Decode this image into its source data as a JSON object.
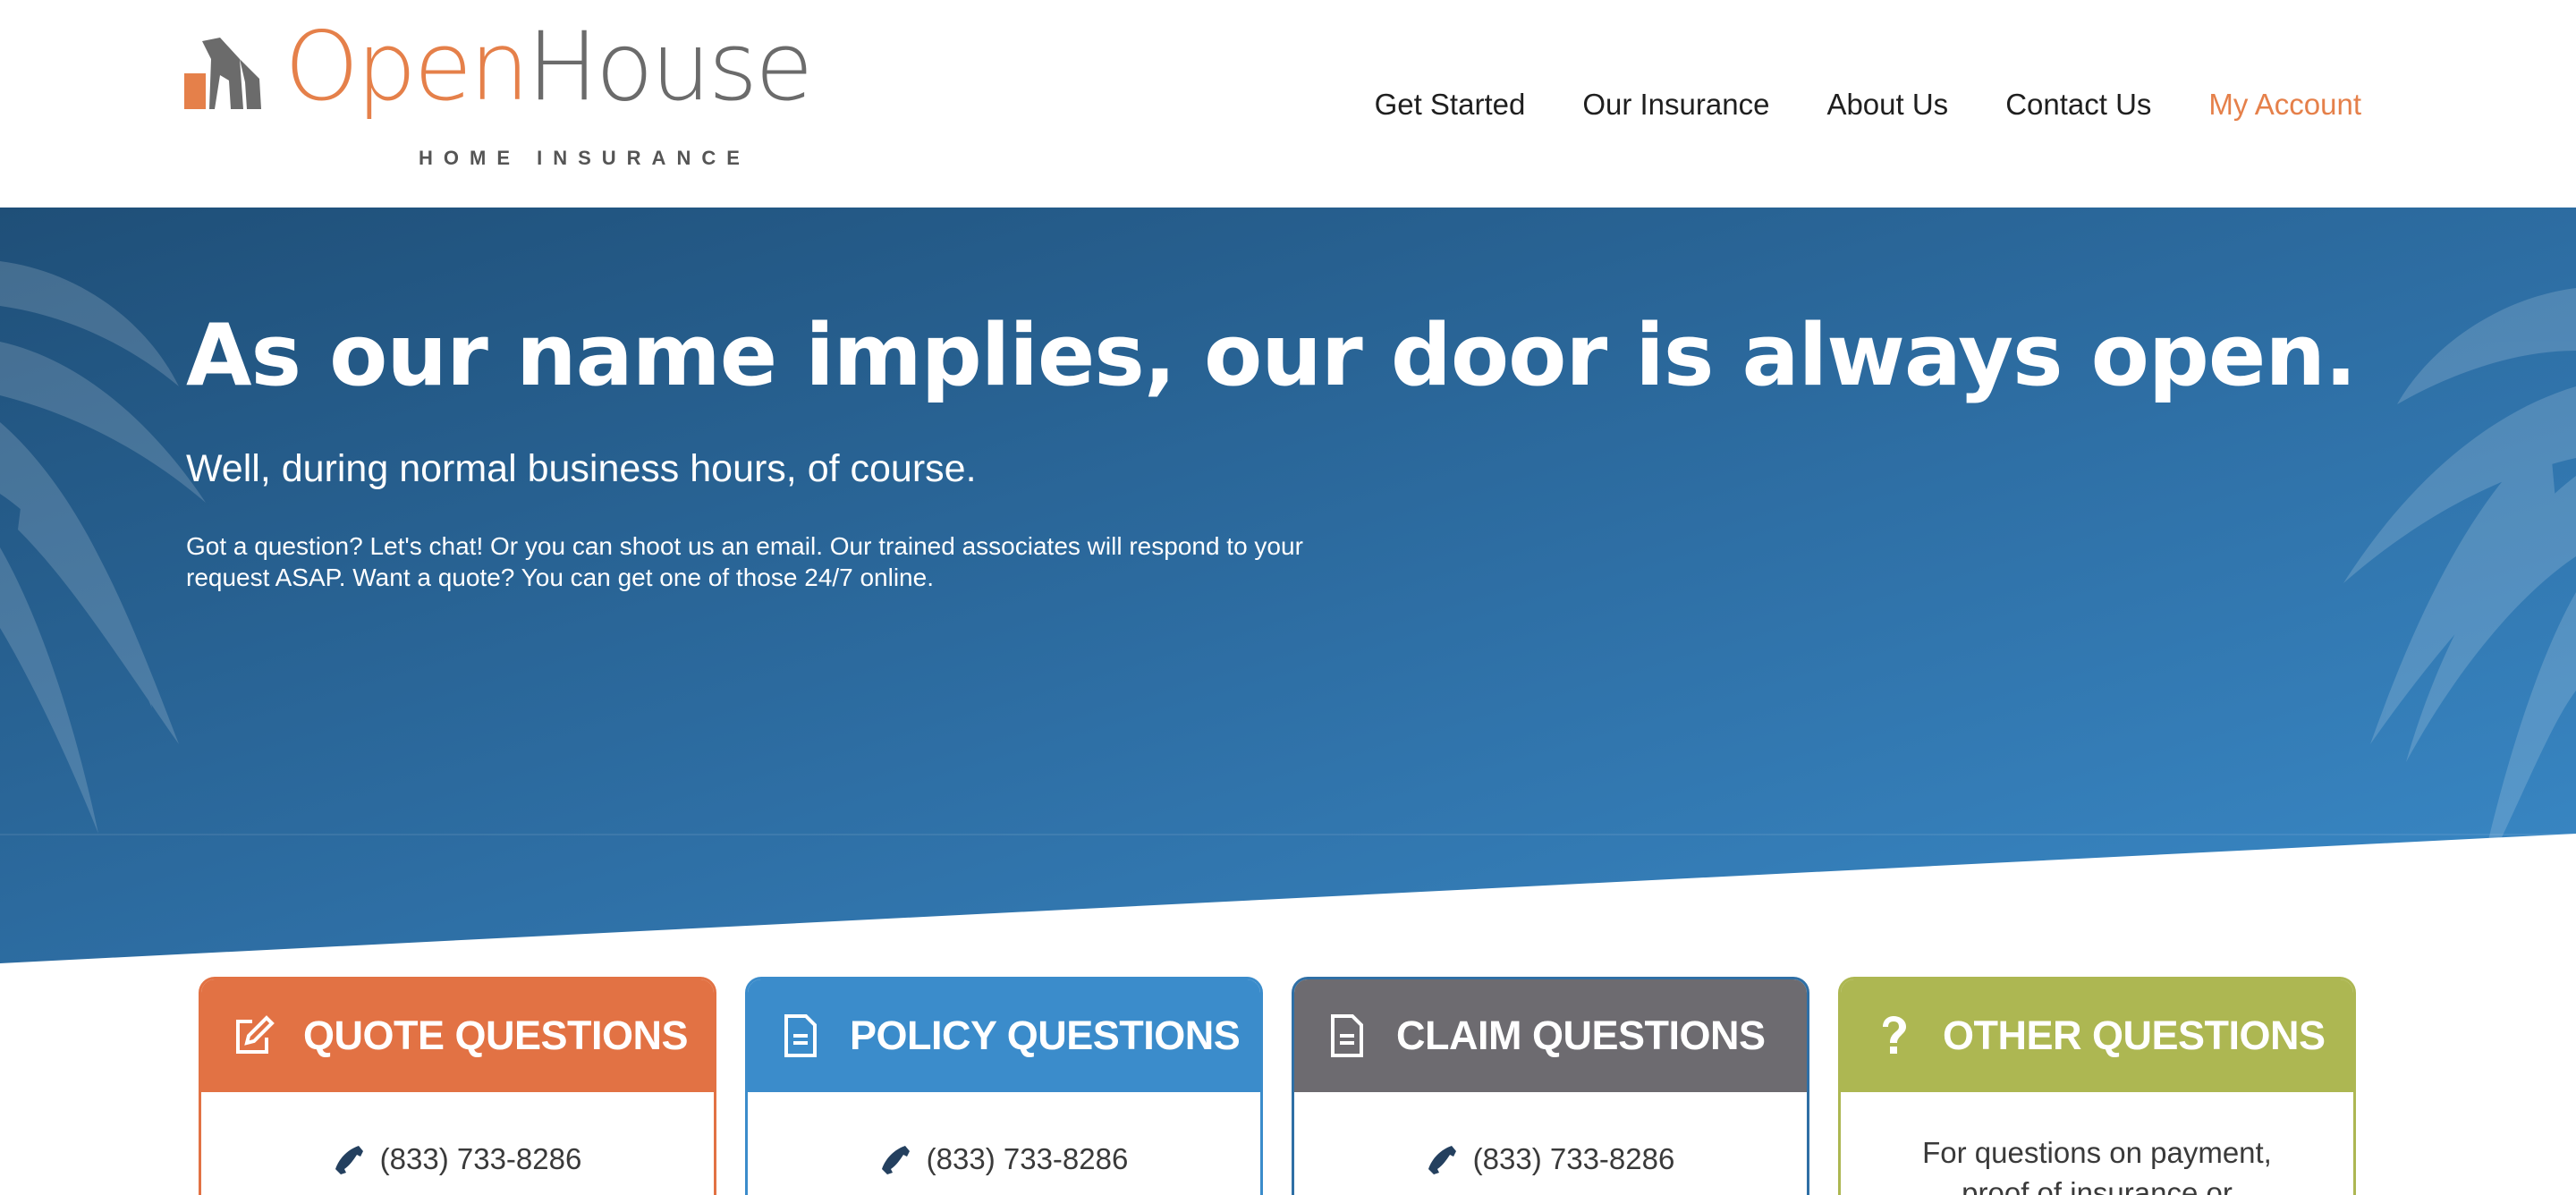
{
  "brand": {
    "name_part1": "Open",
    "name_part2": "House",
    "tagline": "HOME INSURANCE",
    "color_orange": "#e5804a",
    "color_gray": "#6b6b6b"
  },
  "nav": {
    "items": [
      {
        "label": "Get Started"
      },
      {
        "label": "Our Insurance"
      },
      {
        "label": "About Us"
      },
      {
        "label": "Contact Us"
      },
      {
        "label": "My Account"
      }
    ]
  },
  "hero": {
    "title": "As our name implies, our door is always open.",
    "subtitle": "Well, during normal business hours, of course.",
    "body": "Got a question? Let's chat! Or you can shoot us an email. Our trained associates will respond to your request ASAP. Want a quote? You can get one of those 24/7 online."
  },
  "cards": [
    {
      "title": "QUOTE QUESTIONS",
      "icon": "edit-icon",
      "color": "#e27244",
      "phone": "(833) 733-8286"
    },
    {
      "title": "POLICY QUESTIONS",
      "icon": "document-icon",
      "color": "#3b8ccb",
      "phone": "(833) 733-8286"
    },
    {
      "title": "CLAIM QUESTIONS",
      "icon": "document-icon",
      "color": "#6d6b70",
      "phone": "(833) 733-8286"
    },
    {
      "title": "OTHER QUESTIONS",
      "icon": "question-icon",
      "color": "#adb752",
      "text": "For questions on payment, proof of insurance or"
    }
  ]
}
